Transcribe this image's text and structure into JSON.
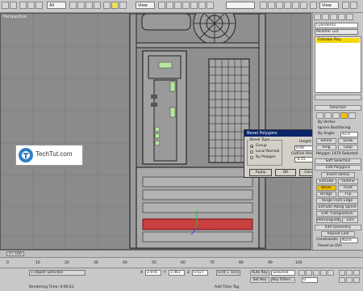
{
  "toolbar": {
    "filter_value": "All",
    "view_value": "View",
    "view2_value": "View"
  },
  "viewport": {
    "label": "Perspective"
  },
  "logo": {
    "text": "TechTut.com"
  },
  "dialog": {
    "title": "Bevel Polygons",
    "group_label": "Bevel Type",
    "options": [
      "Group",
      "Local Normal",
      "By Polygon"
    ],
    "height_label": "Height:",
    "height_value": "0.00",
    "outline_label": "Outline Amount:",
    "outline_value": "-0.15",
    "apply": "Apply",
    "ok": "OK",
    "cancel": "Cancel"
  },
  "panel": {
    "object_name": "Cylinder02",
    "modifier_list": "Modifier List",
    "stack_item": "Editable Poly",
    "selection_head": "Selection",
    "by_vertex": "By Vertex",
    "ignore_backfacing": "Ignore Backfacing",
    "by_angle": "By Angle:",
    "by_angle_value": "45.0",
    "shrink": "Shrink",
    "grow": "Grow",
    "ring": "Ring",
    "loop": "Loop",
    "selected_info": "Polygon 1470 Selected",
    "soft_selection": "Soft Selection",
    "edit_polygons": "Edit Polygons",
    "insert_vertex": "Insert Vertex",
    "extrude": "Extrude",
    "outline": "Outline",
    "bevel": "Bevel",
    "inset": "Inset",
    "bridge": "Bridge",
    "flip": "Flip",
    "hinge_from_edge": "Hinge From Edge",
    "extrude_along_spline": "Extrude Along Spline",
    "edit_triangulation": "Edit Triangulation",
    "retriangulate": "Retriangulate",
    "turn": "Turn",
    "edit_geometry": "Edit Geometry",
    "repeat_last": "Repeat Last",
    "constraints": "Constraints:",
    "constraints_value": "None",
    "preserve_uvs": "Preserve UVs",
    "create": "Create",
    "collapse": "Collapse",
    "attach": "Attach",
    "detach": "Detach"
  },
  "timeline": {
    "frame": "0 / 100"
  },
  "ruler": {
    "ticks": [
      "0",
      "10",
      "20",
      "30",
      "40",
      "50",
      "60",
      "70",
      "80",
      "90",
      "100"
    ]
  },
  "status": {
    "selected": "1 Object Selected",
    "x_label": "X",
    "x_value": "2.976",
    "y_label": "Y",
    "y_value": "1.461",
    "z_label": "Z",
    "z_value": "0.027",
    "grid": "Grid = 10.0",
    "auto_key": "Auto Key",
    "selected_dd": "Selected",
    "set_key": "Set Key",
    "key_filters": "Key Filters...",
    "frame_value": "0",
    "render_time": "Rendering Time: 0:00:21",
    "add_time_tag": "Add Time Tag"
  }
}
